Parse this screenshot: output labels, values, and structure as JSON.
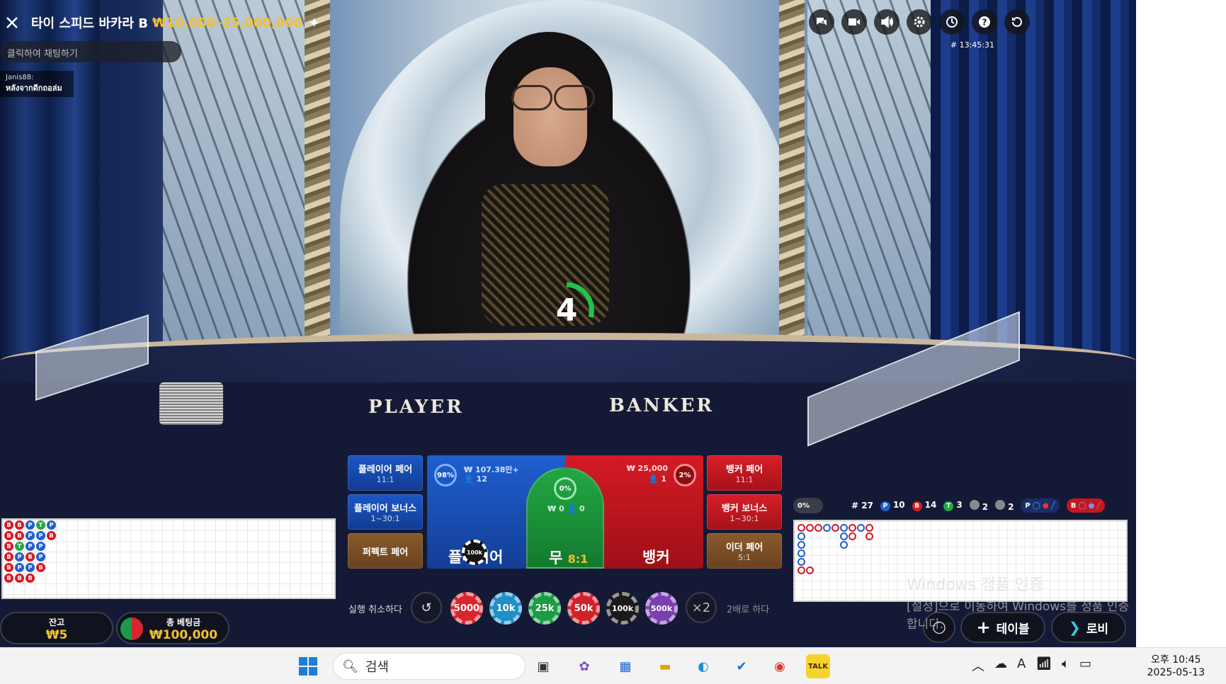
{
  "header": {
    "game_title": "타이 스피드 바카라 B",
    "bet_range": "₩10,000–25,000,000",
    "round_id": "# 13:45:31"
  },
  "chat": {
    "placeholder": "클릭하여 채팅하기",
    "message_user": "Janis88:",
    "message_text": "หลังจากดีกถอล่ม"
  },
  "toolbar_icons": [
    "chat-icon",
    "video-icon",
    "volume-icon",
    "settings-icon",
    "history-icon",
    "help-icon",
    "refresh-icon"
  ],
  "timer": {
    "value": "4"
  },
  "felt": {
    "player": "PLAYER",
    "banker": "BANKER"
  },
  "side_bets": {
    "player_pair": {
      "label": "플레이어 페어",
      "odds": "11:1"
    },
    "player_bonus": {
      "label": "플레이어 보너스",
      "odds": "1~30:1"
    },
    "perfect_pair": {
      "label": "퍼펙트 페어"
    },
    "banker_pair": {
      "label": "뱅커 페어",
      "odds": "11:1"
    },
    "banker_bonus": {
      "label": "뱅커 보너스",
      "odds": "1~30:1"
    },
    "either_pair": {
      "label": "이더 페어",
      "odds": "5:1"
    }
  },
  "main_bets": {
    "player": {
      "label": "플레이어",
      "percent": "98",
      "amount": "₩ 107.38만+",
      "players": "12",
      "chip": "100k"
    },
    "tie": {
      "label": "무",
      "odds": "8:1",
      "percent": "0",
      "amount": "₩ 0",
      "players": "0"
    },
    "banker": {
      "label": "뱅커",
      "percent": "2",
      "amount": "₩ 25,000",
      "players": "1"
    }
  },
  "chip_rail": {
    "undo_label": "실행 취소하다",
    "chips": [
      {
        "label": "5000",
        "color": "#d8262e"
      },
      {
        "label": "10k",
        "color": "#1f8fc6"
      },
      {
        "label": "25k",
        "color": "#1c9a45"
      },
      {
        "label": "50k",
        "color": "#d1222b"
      },
      {
        "label": "100k",
        "color": "#1a1a1a"
      },
      {
        "label": "500k",
        "color": "#7b3fb0"
      }
    ],
    "double_symbol": "×2",
    "double_label": "2배로 하다"
  },
  "balance": {
    "label": "잔고",
    "value": "₩5"
  },
  "total_bet": {
    "label": "총 베팅금",
    "value": "₩100,000"
  },
  "stats": {
    "percent": "0%",
    "round": "# 27",
    "player": "10",
    "banker": "14",
    "tie": "3",
    "player_pair": "2",
    "banker_pair": "2",
    "p_pred": "P",
    "b_pred": "B"
  },
  "bead_road": [
    [
      "B",
      "B",
      "B",
      "B",
      "B",
      "B"
    ],
    [
      "B",
      "B",
      "T",
      "P",
      "P",
      "B"
    ],
    [
      "P",
      "P",
      "P",
      "B",
      "P",
      "B"
    ],
    [
      "T",
      "P",
      "P",
      "P",
      "B",
      ""
    ],
    [
      "P",
      "B",
      "",
      "",
      "",
      ""
    ]
  ],
  "bottom_buttons": {
    "table": "테이블",
    "lobby": "로비"
  },
  "windows_watermark": {
    "line1": "Windows 정품 인증",
    "line2": "[설정]으로 이동하여 Windows를 정품 인증합니다."
  },
  "taskbar": {
    "search": "검색",
    "clock_time": "오후 10:45",
    "clock_date": "2025-05-13"
  },
  "colors": {
    "player": "#1e5fd0",
    "banker": "#d51a24",
    "tie": "#22a744",
    "gold": "#f2c12e"
  }
}
